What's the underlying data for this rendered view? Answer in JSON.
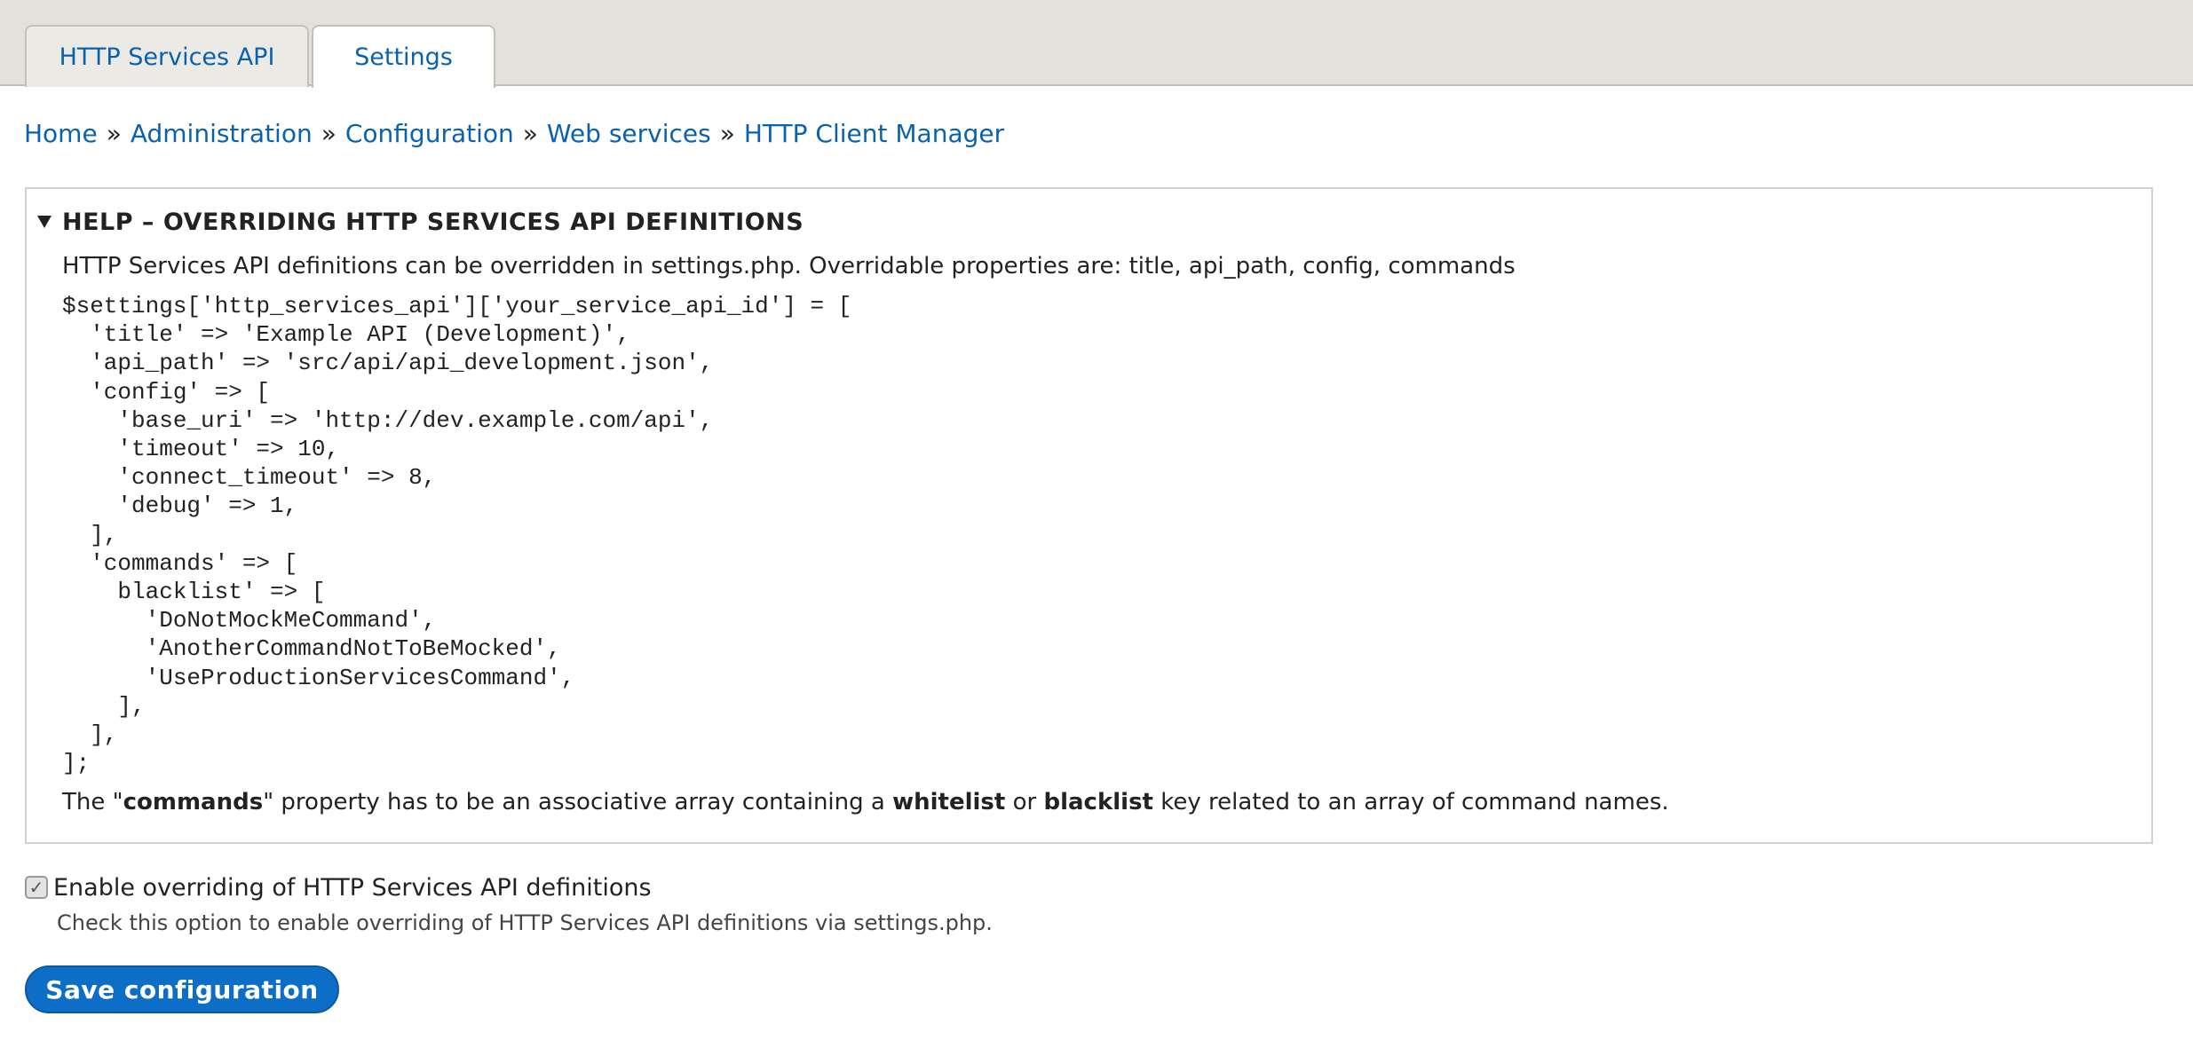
{
  "tabs": [
    {
      "label": "HTTP Services API",
      "active": false
    },
    {
      "label": "Settings",
      "active": true
    }
  ],
  "breadcrumb": [
    "Home",
    "Administration",
    "Configuration",
    "Web services",
    "HTTP Client Manager"
  ],
  "breadcrumb_separator": "»",
  "help": {
    "title": "HELP – OVERRIDING HTTP SERVICES API DEFINITIONS",
    "expanded": true,
    "intro": "HTTP Services API definitions can be overridden in settings.php. Overridable properties are: title, api_path, config, commands",
    "code": "$settings['http_services_api']['your_service_api_id'] = [\n  'title' => 'Example API (Development)',\n  'api_path' => 'src/api/api_development.json',\n  'config' => [\n    'base_uri' => 'http://dev.example.com/api',\n    'timeout' => 10,\n    'connect_timeout' => 8,\n    'debug' => 1,\n  ],\n  'commands' => [\n    blacklist' => [\n      'DoNotMockMeCommand',\n      'AnotherCommandNotToBeMocked',\n      'UseProductionServicesCommand',\n    ],\n  ],\n];",
    "footer": {
      "t1": "The \"",
      "b1": "commands",
      "t2": "\" property has to be an associative array containing a ",
      "b2": "whitelist",
      "t3": " or ",
      "b3": "blacklist",
      "t4": " key related to an array of command names."
    }
  },
  "override_checkbox": {
    "label": "Enable overriding of HTTP Services API definitions",
    "checked": true,
    "description": "Check this option to enable overriding of HTTP Services API definitions via settings.php."
  },
  "save_button": {
    "label": "Save configuration"
  },
  "colors": {
    "link": "#0a62ae",
    "tab_bar": "#e2e1dc",
    "button": "#0d6ec7"
  },
  "icons": {
    "details_toggle": "triangle-down-icon",
    "checkbox_check": "checkmark-icon"
  }
}
